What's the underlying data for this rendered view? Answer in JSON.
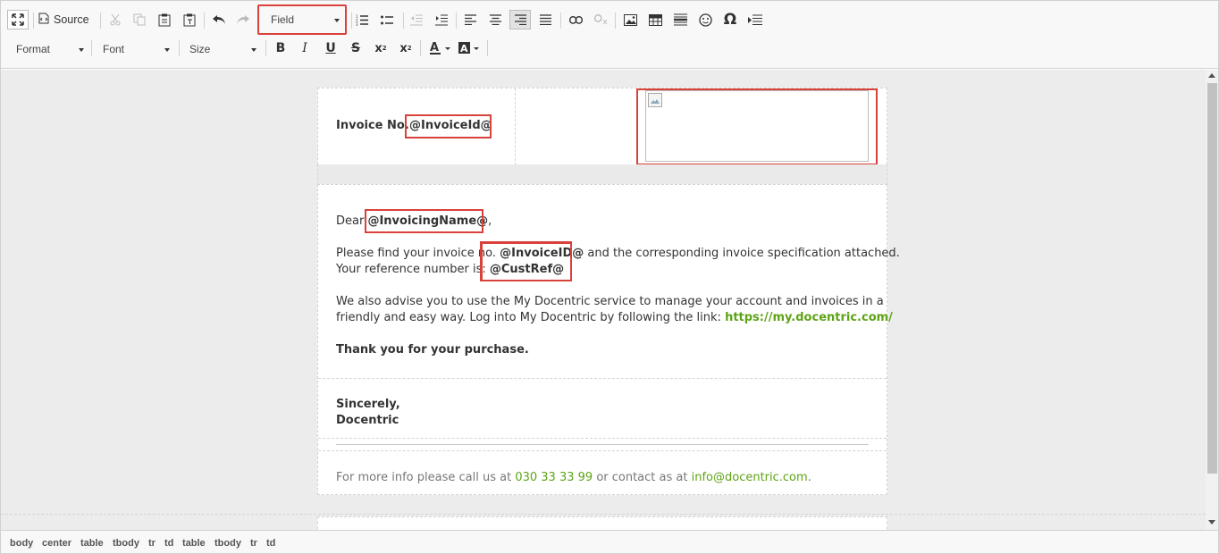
{
  "toolbar": {
    "row1": {
      "source_label": "Source",
      "field_combo_value": "Field"
    },
    "row2": {
      "format_label": "Format",
      "font_label": "Font",
      "size_label": "Size"
    }
  },
  "icons": [
    "maximize-icon",
    "source-icon",
    "cut-icon",
    "copy-icon",
    "paste-icon",
    "paste-text-icon",
    "undo-icon",
    "redo-icon",
    "numbered-list-icon",
    "bulleted-list-icon",
    "outdent-icon",
    "indent-icon",
    "align-left-icon",
    "align-center-icon",
    "align-right-icon",
    "justify-icon",
    "link-icon",
    "unlink-icon",
    "image-icon",
    "table-icon",
    "horizontal-line-icon",
    "smiley-icon",
    "omega-icon",
    "page-break-icon",
    "bold-icon",
    "italic-icon",
    "underline-icon",
    "strikethrough-icon",
    "subscript-icon",
    "superscript-icon",
    "text-color-icon",
    "background-color-icon"
  ],
  "colors": {
    "highlight": "#d9413b",
    "link": "#5ea316",
    "workarea": "#ececec"
  },
  "document": {
    "header": {
      "invoice_label": "Invoice No.",
      "invoice_field": "@InvoiceId@"
    },
    "body": {
      "dear": "Dear",
      "invoicing_name": "@InvoicingName@",
      "comma": ",",
      "find_pre": "Please find your invoice no.",
      "invoice_id_field": "@InvoiceID@",
      "find_post": "and the corresponding invoice specification attached.",
      "ref_pre": "Your reference number is:",
      "cust_ref": "@CustRef@",
      "advise_line1": "We also advise you to use the My Docentric service to manage your account and invoices in a",
      "advise_line2": "friendly and easy way. Log into My Docentric by following the link:",
      "portal_link": "https://my.docentric.com/",
      "thanks": "Thank you for your purchase."
    },
    "signature": {
      "line1": "Sincerely,",
      "line2": "Docentric"
    },
    "footer": {
      "pre": "For more info please call us at",
      "phone": "030 33 33 99",
      "mid": "or contact as at",
      "email": "info@docentric.com",
      "end": "."
    }
  },
  "statusbar": {
    "path": [
      "body",
      "center",
      "table",
      "tbody",
      "tr",
      "td",
      "table",
      "tbody",
      "tr",
      "td"
    ]
  }
}
